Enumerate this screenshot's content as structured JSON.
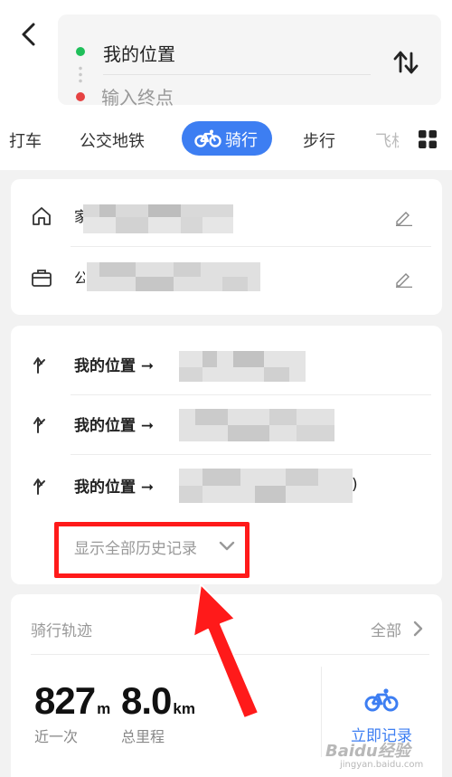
{
  "header": {
    "origin": "我的位置",
    "destination_placeholder": "输入终点"
  },
  "tabs": [
    {
      "label": "打车"
    },
    {
      "label": "公交地铁"
    },
    {
      "label": "骑行",
      "active": true
    },
    {
      "label": "步行"
    },
    {
      "label": "飞机"
    }
  ],
  "places": [
    {
      "icon": "home-icon",
      "label": "家"
    },
    {
      "icon": "briefcase-icon",
      "label": "公"
    }
  ],
  "history": {
    "items": [
      {
        "text": "我的位置 ➞",
        "suffix": ""
      },
      {
        "text": "我的位置 ➞",
        "suffix": ""
      },
      {
        "text": "我的位置 ➞",
        "suffix": ")"
      }
    ],
    "show_all_label": "显示全部历史记录"
  },
  "track": {
    "title": "骑行轨迹",
    "all_label": "全部",
    "stats": [
      {
        "value": "827",
        "unit": "m",
        "label": "近一次"
      },
      {
        "value": "8.0",
        "unit": "km",
        "label": "总里程"
      }
    ],
    "record_label": "立即记录"
  },
  "watermark": {
    "text": "Baidu经验",
    "sub": "jingyan.baidu.com"
  },
  "colors": {
    "accent": "#3d7ef2",
    "origin_dot": "#1fbf5a",
    "dest_dot": "#e64242",
    "annotation": "#ff1a1a"
  }
}
